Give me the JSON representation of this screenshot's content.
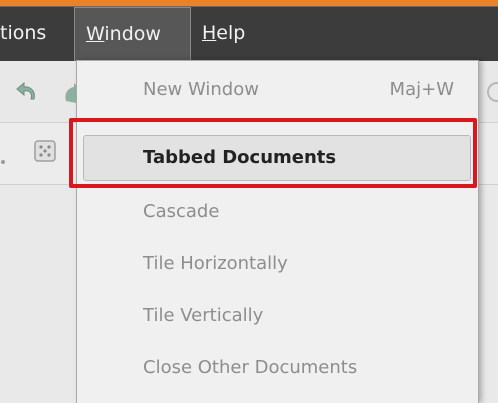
{
  "menubar": {
    "items": [
      {
        "label": "tions"
      },
      {
        "label_mnemonic": "W",
        "label_rest": "indow"
      },
      {
        "label_mnemonic": "H",
        "label_rest": "elp"
      }
    ]
  },
  "toolbar": {
    "icons": [
      "undo-icon",
      "redo-icon",
      "dice-icon",
      "partial-icon"
    ]
  },
  "window_menu": {
    "items": [
      {
        "label": "New Window",
        "shortcut": "Maj+W"
      },
      {
        "label": "Tabbed Documents"
      },
      {
        "label": "Cascade"
      },
      {
        "label": "Tile Horizontally"
      },
      {
        "label": "Tile Vertically"
      },
      {
        "label": "Close Other Documents"
      }
    ]
  },
  "colors": {
    "accent_orange": "#e98228",
    "highlight_border": "#d9171f",
    "menubar_bg": "#3c3c3c"
  }
}
